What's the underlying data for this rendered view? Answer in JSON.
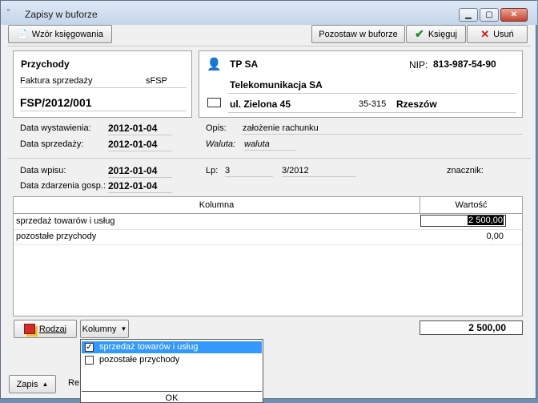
{
  "window": {
    "title": "Zapisy w buforze"
  },
  "toolbar": {
    "template_label": "Wzór księgowania",
    "leave_label": "Pozostaw w buforze",
    "post_label": "Księguj",
    "delete_label": "Usuń"
  },
  "document": {
    "type_title": "Przychody",
    "doc_kind": "Faktura sprzedaży",
    "doc_code": "sFSP",
    "doc_number": "FSP/2012/001"
  },
  "contractor": {
    "short_name": "TP SA",
    "nip_label": "NIP:",
    "nip": "813-987-54-90",
    "full_name": "Telekomunikacja SA",
    "street": "ul. Zielona 45",
    "postal_code": "35-315",
    "city": "Rzeszów"
  },
  "dates": {
    "issue_label": "Data wystawienia:",
    "issue_value": "2012-01-04",
    "sale_label": "Data sprzedaży:",
    "sale_value": "2012-01-04",
    "entry_label": "Data wpisu:",
    "entry_value": "2012-01-04",
    "event_label": "Data zdarzenia gosp.:",
    "event_value": "2012-01-04"
  },
  "description": {
    "label": "Opis:",
    "value": "założenie rachunku",
    "currency_label": "Waluta:",
    "currency_value": "waluta"
  },
  "lp": {
    "label": "Lp:",
    "number": "3",
    "ref": "3/2012",
    "tag_label": "znacznik:"
  },
  "table": {
    "col_name": "Kolumna",
    "col_value": "Wartość",
    "rows": [
      {
        "name": "sprzedaż towarów i usług",
        "value": "2 500,00"
      },
      {
        "name": "pozostałe przychody",
        "value": "0,00"
      }
    ]
  },
  "footer": {
    "kind_label": "Rodzaj",
    "columns_label": "Kolumny",
    "total": "2 500,00",
    "save_label": "Zapis",
    "partial_label": "Re"
  },
  "columns_menu": {
    "items": [
      {
        "label": "sprzedaż towarów i usług",
        "checked": true
      },
      {
        "label": "pozostałe przychody",
        "checked": false
      }
    ],
    "ok_label": "OK"
  }
}
